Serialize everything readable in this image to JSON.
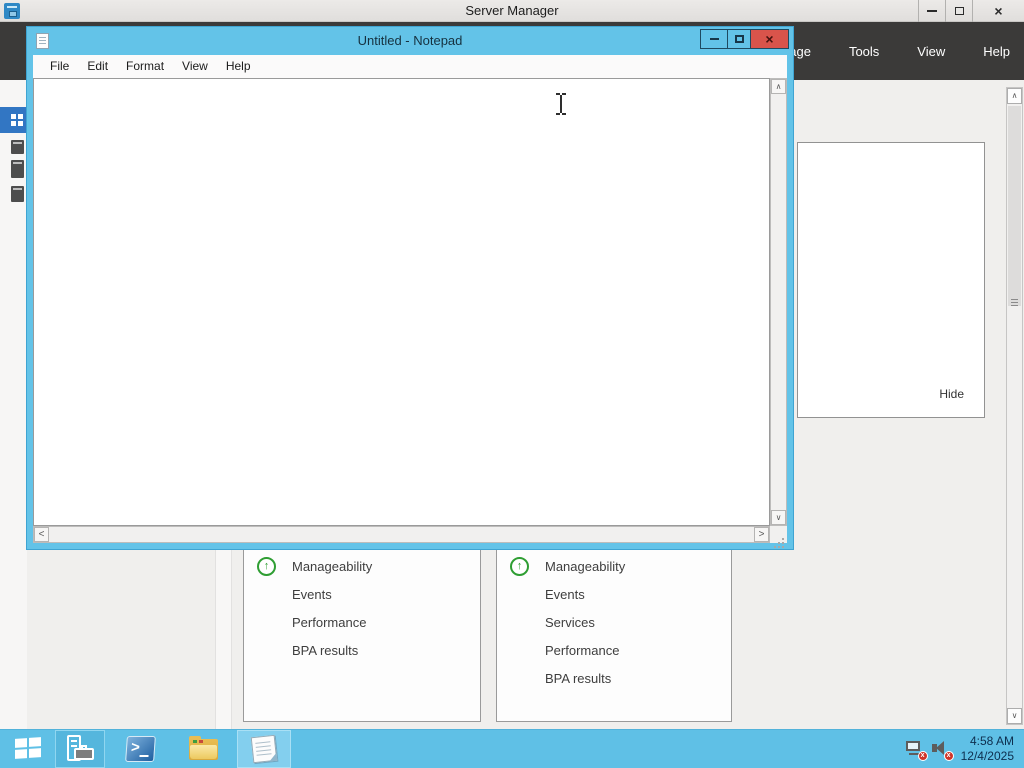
{
  "server_manager": {
    "title": "Server Manager",
    "menu": [
      "Manage",
      "Tools",
      "View",
      "Help"
    ],
    "panel": {
      "hide_label": "Hide"
    },
    "tiles": [
      {
        "items": [
          "Manageability",
          "Events",
          "Performance",
          "BPA results"
        ]
      },
      {
        "items": [
          "Manageability",
          "Events",
          "Services",
          "Performance",
          "BPA results"
        ]
      }
    ],
    "colors": {
      "header_bg": "#3b3a39",
      "sidebar_selected": "#3276c3",
      "status_green": "#2f9e33"
    }
  },
  "notepad": {
    "title": "Untitled - Notepad",
    "menu": [
      "File",
      "Edit",
      "Format",
      "View",
      "Help"
    ],
    "text_value": "",
    "colors": {
      "chrome_blue": "#63c3e8",
      "close_red": "#d9544b"
    }
  },
  "taskbar": {
    "clock_time": "4:58 AM",
    "clock_date": "12/4/2025",
    "colors": {
      "bar_blue": "#5fc0e6"
    }
  },
  "icons": {
    "close": "×",
    "chevron_up": "∧",
    "chevron_down": "∨",
    "chevron_left": "<",
    "chevron_right": ">",
    "status_up_arrow": "↑"
  }
}
